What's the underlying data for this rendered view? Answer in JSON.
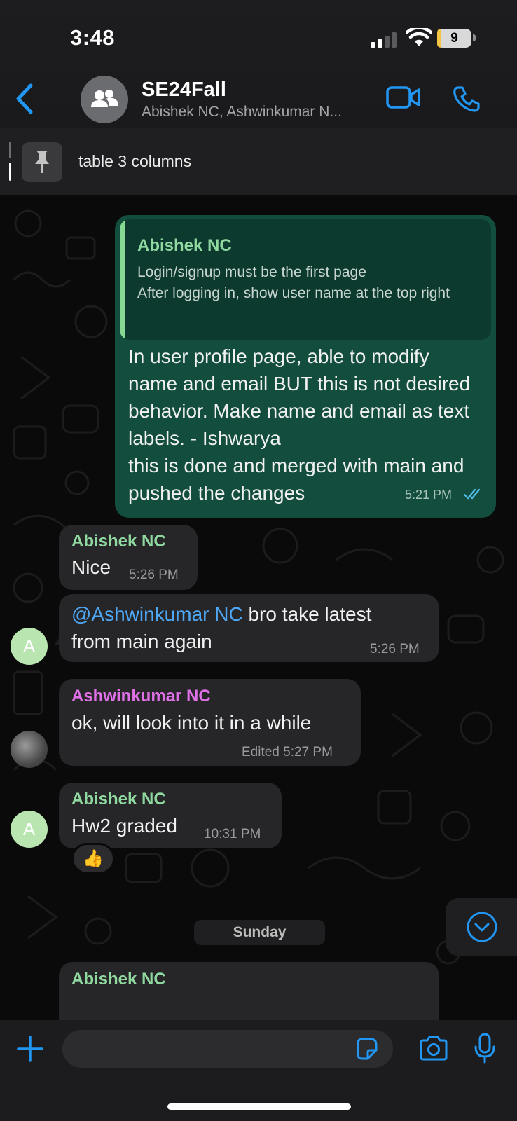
{
  "status_bar": {
    "time": "3:48",
    "battery": "9"
  },
  "header": {
    "title": "SE24Fall",
    "subtitle": "Abishek NC, Ashwinkumar N..."
  },
  "pinned": {
    "text": "table 3 columns"
  },
  "messages": {
    "outgoing": {
      "quote_sender": "Abishek NC",
      "quote_text": "Login/signup must be the first page\nAfter logging in, show user name at the top right",
      "text": "In user profile page, able to modify name and email BUT this is not desired behavior. Make name and email as text labels. - Ishwarya\nthis is done and merged with main and pushed the changes",
      "time": "5:21 PM"
    },
    "m1": {
      "sender": "Abishek NC",
      "text": "Nice",
      "time": "5:26 PM"
    },
    "m2": {
      "mention": "@Ashwinkumar NC",
      "line1_rest": " bro take latest",
      "line2": "from main again",
      "time": "5:26 PM",
      "avatar": "A"
    },
    "m3": {
      "sender": "Ashwinkumar NC",
      "text": "ok, will look into it in a while",
      "time": "Edited 5:27 PM"
    },
    "m4": {
      "sender": "Abishek NC",
      "text": "Hw2 graded",
      "time": "10:31 PM",
      "avatar": "A",
      "reaction": "👍"
    },
    "date_separator": "Sunday",
    "m5": {
      "sender": "Abishek NC"
    }
  },
  "colors": {
    "outgoing_bubble": "#134d3e",
    "incoming_bubble": "#262628",
    "accent_blue": "#2196f3",
    "sender_green": "#8fd9a0",
    "sender_pink": "#e070e8"
  },
  "icons": [
    "back-chevron-icon",
    "group-icon",
    "video-call-icon",
    "phone-call-icon",
    "pin-icon",
    "double-check-icon",
    "scroll-down-icon",
    "plus-icon",
    "sticker-icon",
    "camera-icon",
    "microphone-icon"
  ]
}
